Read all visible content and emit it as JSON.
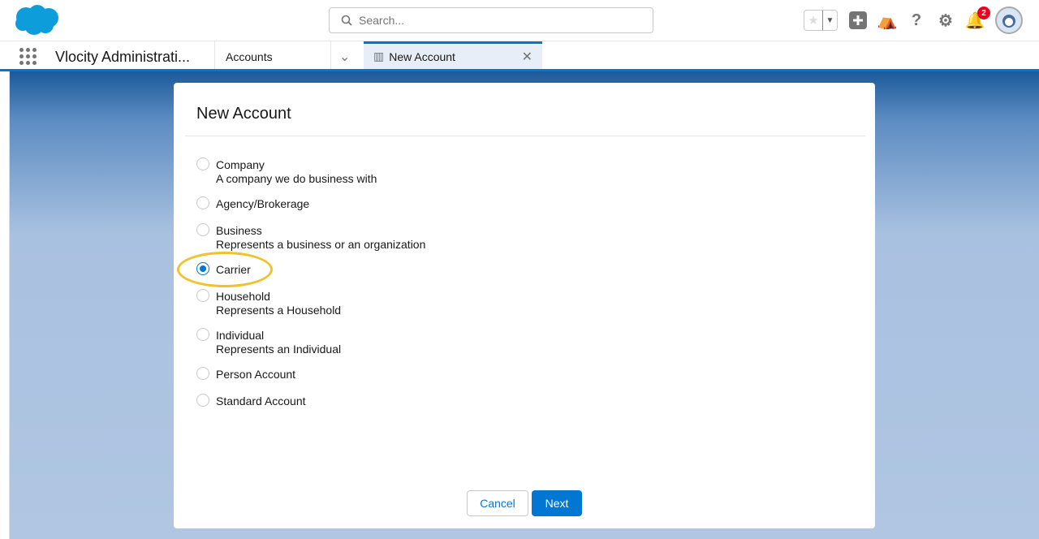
{
  "header": {
    "search_placeholder": "Search...",
    "notification_count": "2"
  },
  "nav": {
    "app_name": "Vlocity Administrati...",
    "tab_accounts": "Accounts",
    "tab_new_account": "New Account"
  },
  "modal": {
    "title": "New Account",
    "options": [
      {
        "label": "Company",
        "desc": "A company we do business with",
        "selected": false
      },
      {
        "label": "Agency/Brokerage",
        "desc": "",
        "selected": false
      },
      {
        "label": "Business",
        "desc": "Represents a business or an organization",
        "selected": false
      },
      {
        "label": "Carrier",
        "desc": "",
        "selected": true
      },
      {
        "label": "Household",
        "desc": "Represents a Household",
        "selected": false
      },
      {
        "label": "Individual",
        "desc": "Represents an Individual",
        "selected": false
      },
      {
        "label": "Person Account",
        "desc": "",
        "selected": false
      },
      {
        "label": "Standard Account",
        "desc": "",
        "selected": false
      }
    ],
    "cancel": "Cancel",
    "next": "Next"
  },
  "colors": {
    "brand": "#0176d3",
    "highlight": "#f0c22c"
  }
}
